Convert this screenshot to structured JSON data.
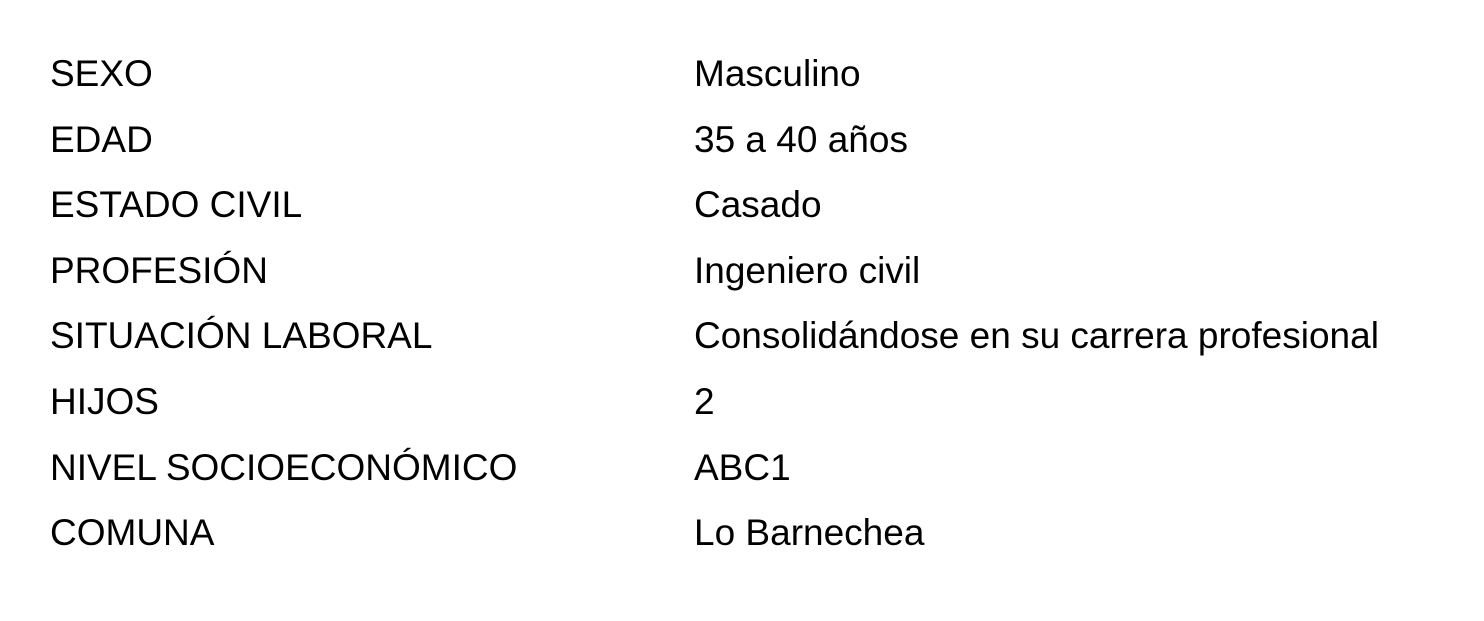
{
  "profile": {
    "rows": [
      {
        "label": "SEXO",
        "value": "Masculino"
      },
      {
        "label": "EDAD",
        "value": "35 a 40 años"
      },
      {
        "label": "ESTADO CIVIL",
        "value": "Casado"
      },
      {
        "label": "PROFESIÓN",
        "value": "Ingeniero civil"
      },
      {
        "label": "SITUACIÓN LABORAL",
        "value": "Consolidándose en su carrera profesional"
      },
      {
        "label": "HIJOS",
        "value": "2"
      },
      {
        "label": "NIVEL SOCIOECONÓMICO",
        "value": "ABC1"
      },
      {
        "label": "COMUNA",
        "value": "Lo Barnechea"
      }
    ]
  }
}
